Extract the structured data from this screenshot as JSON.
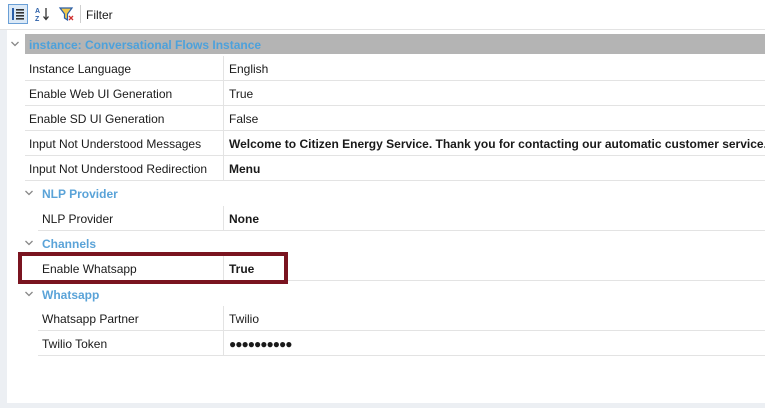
{
  "toolbar": {
    "categorized_icon": "categorized-view-icon",
    "alpha_icon": "alphabetical-sort-icon",
    "filter_icon": "filter-funnel-icon",
    "filter_label": "Filter"
  },
  "instance": {
    "header": "instance: Conversational Flows Instance",
    "properties": [
      {
        "name": "Instance Language",
        "value": "English",
        "bold": false
      },
      {
        "name": "Enable Web UI Generation",
        "value": "True",
        "bold": false
      },
      {
        "name": "Enable SD UI Generation",
        "value": "False",
        "bold": false
      },
      {
        "name": "Input Not Understood Messages",
        "value": "Welcome to Citizen Energy Service. Thank you for contacting our automatic customer service.",
        "bold": true
      },
      {
        "name": "Input Not Understood Redirection",
        "value": "Menu",
        "bold": true
      }
    ]
  },
  "nlp": {
    "header": "NLP Provider",
    "properties": [
      {
        "name": "NLP Provider",
        "value": "None",
        "bold": true
      }
    ]
  },
  "channels": {
    "header": "Channels",
    "properties": [
      {
        "name": "Enable Whatsapp",
        "value": "True",
        "bold": true
      }
    ]
  },
  "whatsapp": {
    "header": "Whatsapp",
    "properties": [
      {
        "name": "Whatsapp Partner",
        "value": "Twilio",
        "bold": false
      },
      {
        "name": "Twilio Token",
        "value": "●●●●●●●●●●",
        "bold": true
      }
    ]
  },
  "colors": {
    "category_text": "#5aa3d8",
    "instance_bar": "#b4b4b4",
    "highlight_border": "#7a1420"
  }
}
